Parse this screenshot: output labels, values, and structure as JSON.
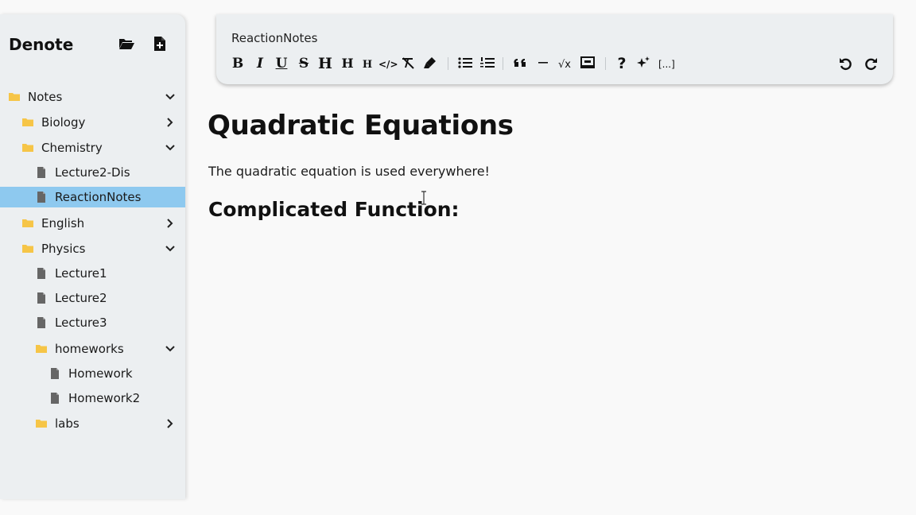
{
  "sidebar": {
    "app_name": "Denote",
    "open_folder_icon": "folder-open-icon",
    "new_file_icon": "file-plus-icon",
    "items": [
      {
        "label": "Notes",
        "kind": "folder",
        "expanded": true,
        "level": 0
      },
      {
        "label": "Biology",
        "kind": "folder",
        "expanded": false,
        "level": 1
      },
      {
        "label": "Chemistry",
        "kind": "folder",
        "expanded": true,
        "level": 1
      },
      {
        "label": "Lecture2-Dis",
        "kind": "file",
        "level": 2
      },
      {
        "label": "ReactionNotes",
        "kind": "file",
        "level": 2,
        "selected": true
      },
      {
        "label": "English",
        "kind": "folder",
        "expanded": false,
        "level": 1
      },
      {
        "label": "Physics",
        "kind": "folder",
        "expanded": true,
        "level": 1
      },
      {
        "label": "Lecture1",
        "kind": "file",
        "level": 2
      },
      {
        "label": "Lecture2",
        "kind": "file",
        "level": 2
      },
      {
        "label": "Lecture3",
        "kind": "file",
        "level": 2
      },
      {
        "label": "homeworks",
        "kind": "folder",
        "expanded": true,
        "level": 2
      },
      {
        "label": "Homework",
        "kind": "file",
        "level": 3
      },
      {
        "label": "Homework2",
        "kind": "file",
        "level": 3
      },
      {
        "label": "labs",
        "kind": "folder",
        "expanded": false,
        "level": 2
      }
    ]
  },
  "toolbar": {
    "title": "ReactionNotes",
    "buttons": [
      {
        "label": "B",
        "icon": "bold-icon"
      },
      {
        "label": "I",
        "icon": "italic-icon"
      },
      {
        "label": "U",
        "icon": "underline-icon"
      },
      {
        "label": "S",
        "icon": "strikethrough-icon"
      },
      {
        "label": "H",
        "icon": "heading1-icon"
      },
      {
        "label": "H",
        "icon": "heading2-icon"
      },
      {
        "label": "H",
        "icon": "heading3-icon"
      },
      {
        "label": "</>",
        "icon": "code-icon"
      },
      {
        "label": "",
        "icon": "clear-format-icon"
      },
      {
        "label": "",
        "icon": "highlight-icon"
      },
      {
        "label": "",
        "icon": "bullet-list-icon"
      },
      {
        "label": "",
        "icon": "numbered-list-icon"
      },
      {
        "label": "",
        "icon": "quote-icon"
      },
      {
        "label": "",
        "icon": "horizontal-rule-icon"
      },
      {
        "label": "√x",
        "icon": "math-icon"
      },
      {
        "label": "",
        "icon": "code-block-icon"
      },
      {
        "label": "?",
        "icon": "help-icon"
      },
      {
        "label": "",
        "icon": "ai-sparkle-icon"
      },
      {
        "label": "[...]",
        "icon": "cloze-icon"
      },
      {
        "label": "",
        "icon": "undo-icon"
      },
      {
        "label": "",
        "icon": "redo-icon"
      }
    ]
  },
  "document": {
    "heading": "Quadratic Equations",
    "paragraph": "The quadratic equation is used everywhere!",
    "subheading": "Complicated Function:"
  },
  "colors": {
    "sidebar_bg": "#eceff1",
    "selected_bg": "#8ec9ef",
    "folder": "#f6c547",
    "file": "#666666"
  }
}
